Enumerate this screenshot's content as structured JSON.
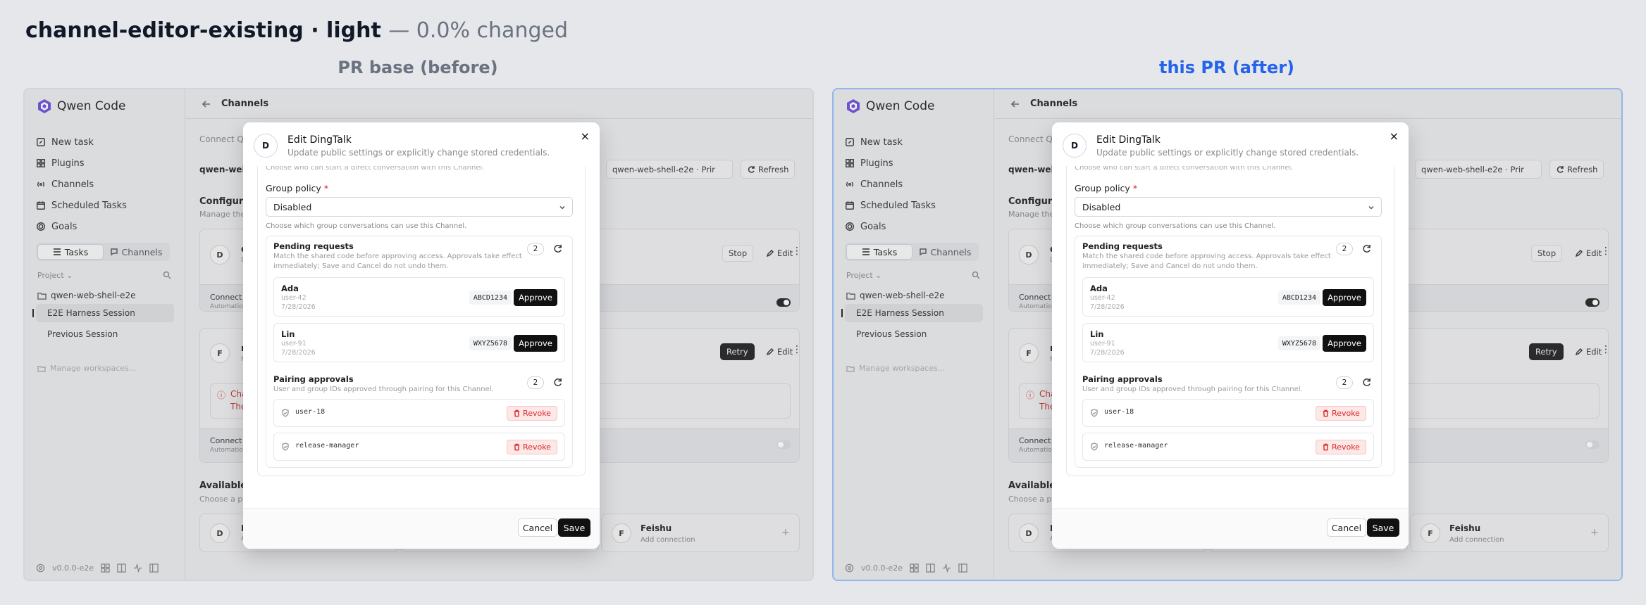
{
  "header": {
    "title": "channel-editor-existing · light",
    "subtitle": "— 0.0% changed"
  },
  "panes": {
    "before_label": "PR base (before)",
    "after_label": "this PR (after)"
  },
  "app": {
    "brand": "Qwen Code",
    "nav": [
      "New task",
      "Plugins",
      "Channels",
      "Scheduled Tasks",
      "Goals"
    ],
    "tabs": {
      "tasks": "Tasks",
      "channels": "Channels"
    },
    "project_label": "Project",
    "workspace": "qwen-web-shell-e2e",
    "sessions": [
      "E2E Harness Session",
      "Previous Session"
    ],
    "manage": "Manage workspaces...",
    "version": "v0.0.0-e2e",
    "page_title": "Channels",
    "bg": {
      "connect_q": "Connect Q",
      "workspace_name": "qwen-web",
      "select_value": "qwen-web-shell-e2e · Prir",
      "refresh": "Refresh",
      "configured": "Configur",
      "manage_the": "Manage the",
      "card1_letter": "D",
      "card1_title": "d",
      "card1_sub": "D",
      "stop": "Stop",
      "edit": "Edit",
      "connect": "Connect",
      "automation": "Automatio",
      "card2_letter": "F",
      "card2_title": "r",
      "card2_sub": "F",
      "retry": "Retry",
      "err_line1": "Cha",
      "err_line2": "The",
      "available": "Available",
      "choose": "Choose a p",
      "avail1_letter": "D",
      "avail1_title": "D",
      "avail1_sub": "A",
      "feishu_letter": "F",
      "feishu": "Feishu",
      "add_connection": "Add connection",
      "plus": "+"
    }
  },
  "modal": {
    "avatar": "D",
    "title": "Edit DingTalk",
    "subtitle": "Update public settings or explicitly change stored credentials.",
    "close": "×",
    "clip_hint": "Choose who can start a direct conversation with this Channel.",
    "group_policy_label": "Group policy",
    "required": "*",
    "group_policy_value": "Disabled",
    "group_policy_help": "Choose which group conversations can use this Channel.",
    "pending": {
      "title": "Pending requests",
      "desc1": "Match the shared code before approving access. Approvals take effect",
      "desc2": "immediately; Save and Cancel do not undo them.",
      "count": "2",
      "items": [
        {
          "name": "Ada",
          "user": "user-42",
          "date": "7/28/2026",
          "code": "ABCD1234",
          "action": "Approve"
        },
        {
          "name": "Lin",
          "user": "user-91",
          "date": "7/28/2026",
          "code": "WXYZ5678",
          "action": "Approve"
        }
      ]
    },
    "approvals": {
      "title": "Pairing approvals",
      "desc": "User and group IDs approved through pairing for this Channel.",
      "count": "2",
      "items": [
        {
          "id": "user-18",
          "action": "Revoke"
        },
        {
          "id": "release-manager",
          "action": "Revoke"
        }
      ]
    },
    "cancel": "Cancel",
    "save": "Save"
  }
}
